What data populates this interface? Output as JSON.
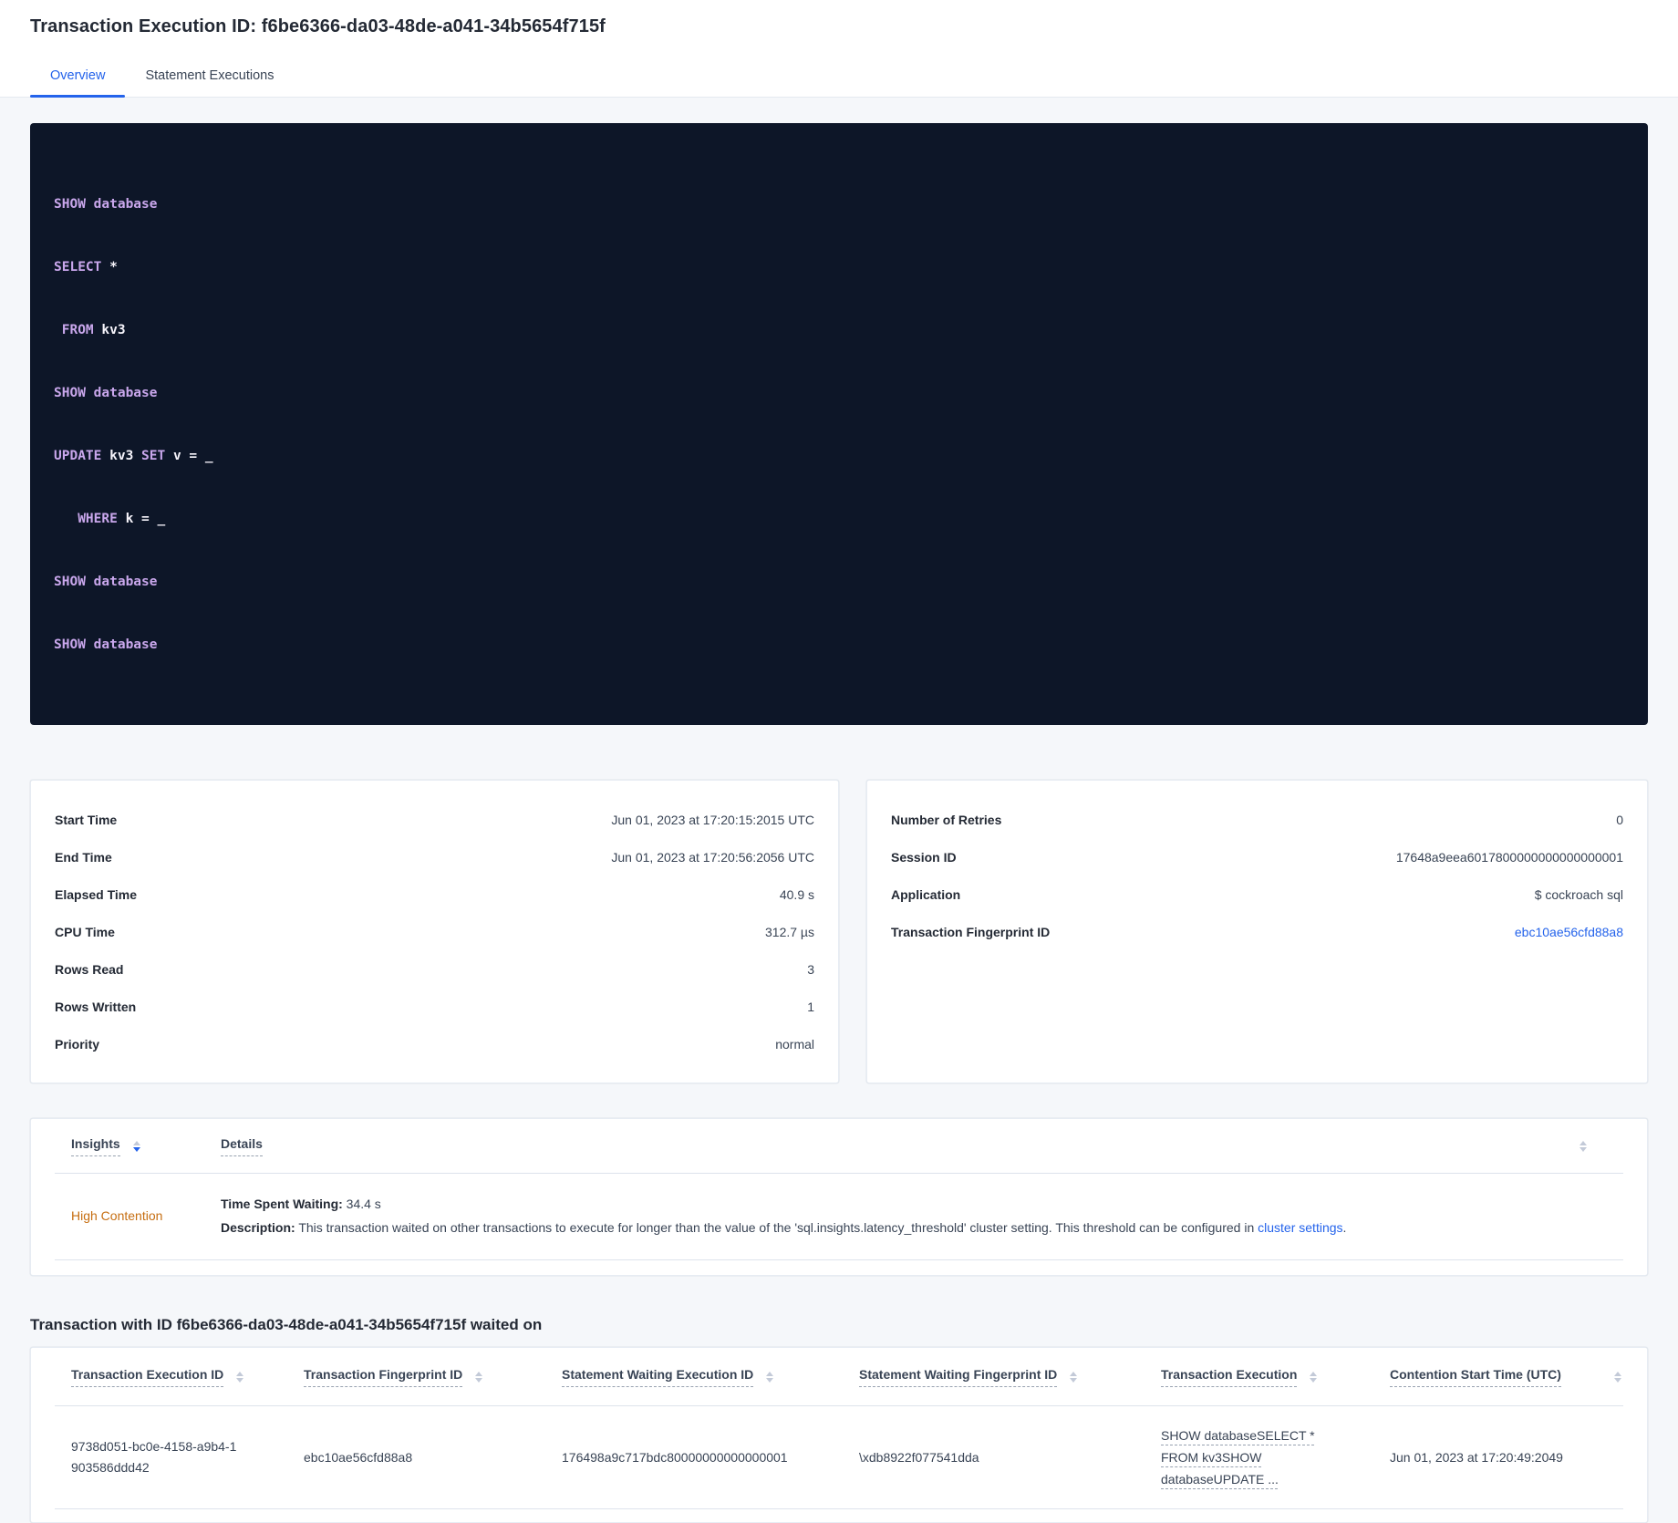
{
  "header": {
    "title": "Transaction Execution ID: f6be6366-da03-48de-a041-34b5654f715f"
  },
  "tabs": [
    {
      "label": "Overview"
    },
    {
      "label": "Statement Executions"
    }
  ],
  "colors": {
    "accent_blue": "#2463eb",
    "insight_orange": "#c66e11",
    "code_background": "#0d1628",
    "code_keyword": "#c9a7ec"
  },
  "sql": {
    "lines": [
      {
        "segs": [
          {
            "v": "SHOW database"
          }
        ]
      },
      {
        "segs": [
          {
            "v": "SELECT"
          },
          {
            "v": " *"
          }
        ]
      },
      {
        "segs": [
          {
            "v": " FROM"
          },
          {
            "v": " kv3"
          }
        ]
      },
      {
        "segs": [
          {
            "v": "SHOW database"
          }
        ]
      },
      {
        "segs": [
          {
            "v": "UPDATE"
          },
          {
            "v": " kv3"
          },
          {
            "v": " SET"
          },
          {
            "v": " v = _"
          }
        ]
      },
      {
        "segs": [
          {
            "v": "   WHERE"
          },
          {
            "v": " k = _"
          }
        ]
      },
      {
        "segs": [
          {
            "v": "SHOW database"
          }
        ]
      },
      {
        "segs": [
          {
            "v": "SHOW database"
          }
        ]
      }
    ]
  },
  "summary_left": {
    "rows": [
      {
        "label": "Start Time",
        "value": "Jun 01, 2023 at 17:20:15:2015 UTC"
      },
      {
        "label": "End Time",
        "value": "Jun 01, 2023 at 17:20:56:2056 UTC"
      },
      {
        "label": "Elapsed Time",
        "value": "40.9 s"
      },
      {
        "label": "CPU Time",
        "value": "312.7 µs"
      },
      {
        "label": "Rows Read",
        "value": "3"
      },
      {
        "label": "Rows Written",
        "value": "1"
      },
      {
        "label": "Priority",
        "value": "normal"
      }
    ]
  },
  "summary_right": {
    "rows": [
      {
        "label": "Number of Retries",
        "value": "0"
      },
      {
        "label": "Session ID",
        "value": "17648a9eea6017800000000000000001"
      },
      {
        "label": "Application",
        "value": "$ cockroach sql"
      },
      {
        "label": "Transaction Fingerprint ID",
        "value": "ebc10ae56cfd88a8"
      }
    ]
  },
  "insights": {
    "col_insights": "Insights",
    "col_details": "Details",
    "row": {
      "insight": "High Contention",
      "waiting_label": "Time Spent Waiting:",
      "waiting_value": "34.4 s",
      "description_label": "Description:",
      "description_text": "This transaction waited on other transactions to execute for longer than the value of the 'sql.insights.latency_threshold' cluster setting. This threshold can be configured in",
      "link_text": "cluster settings",
      "link_suffix": "."
    }
  },
  "waited_on": {
    "title": "Transaction with ID f6be6366-da03-48de-a041-34b5654f715f waited on",
    "columns": [
      "Transaction Execution ID",
      "Transaction Fingerprint ID",
      "Statement Waiting Execution ID",
      "Statement Waiting Fingerprint ID",
      "Transaction Execution",
      "Contention Start Time (UTC)"
    ],
    "row": {
      "transaction_execution_id": "9738d051-bc0e-4158-a9b4-1903586ddd42",
      "transaction_fingerprint_id": "ebc10ae56cfd88a8",
      "statement_waiting_execution_id": "176498a9c717bdc80000000000000001",
      "statement_waiting_fingerprint_id": "\\xdb8922f077541dda",
      "transaction_execution_lines": [
        "SHOW databaseSELECT *",
        "FROM kv3SHOW",
        "databaseUPDATE ..."
      ],
      "contention_start_time": "Jun 01, 2023 at 17:20:49:2049"
    }
  }
}
